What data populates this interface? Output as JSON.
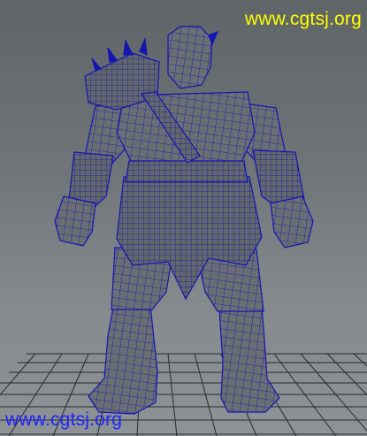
{
  "viewport": {
    "watermark_top": "www.cgtsj.org",
    "watermark_bottom": "www.cgtsj.org"
  },
  "colors": {
    "background_top": "#5f6467",
    "background_bottom": "#8d9296",
    "grid_lines": "#1a1a1a",
    "wireframe": "#1515b0",
    "mesh_fill": "#6a6f73",
    "watermark_top": "#ffff00",
    "watermark_bottom": "#1f24ff"
  },
  "scene": {
    "subject": "orc-warrior-wireframe-model",
    "icons": [
      "ground-grid",
      "character-mesh"
    ]
  }
}
